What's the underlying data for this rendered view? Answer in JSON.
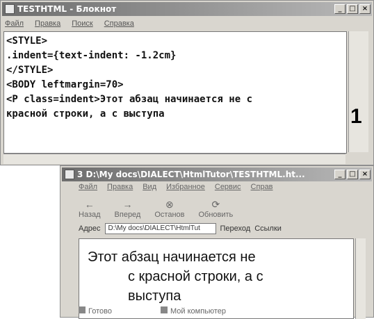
{
  "notepad": {
    "title": "TESTHTML - Блокнот",
    "menu": [
      "Файл",
      "Правка",
      "Поиск",
      "Справка"
    ],
    "lines": [
      "<STYLE>",
      ".indent={text-indent: -1.2cm}",
      "</STYLE>",
      "<BODY leftmargin=70>",
      "<P class=indent>Этот абзац начинается не с",
      "красной строки, а с выступа"
    ]
  },
  "figure_number": "1",
  "browser": {
    "title": "3  D:\\My  docs\\DIALECT\\HtmlTutor\\TESTHTML.ht...",
    "menu": [
      "Файл",
      "Правка",
      "Вид",
      "Избранное",
      "Сервис",
      "Справ"
    ],
    "toolbar": [
      "Назад",
      "Вперед",
      "Останов",
      "Обновить"
    ],
    "address_label": "Адрес",
    "address_value": "D:\\My docs\\DIALECT\\HtmlTut",
    "go_label": "Переход",
    "links_label": "Ссылки",
    "content": {
      "line1": "Этот абзац начинается не",
      "line2": "с красной строки, а с",
      "line3": "выступа"
    },
    "status": {
      "left": "Готово",
      "right": "Мой компьютер"
    }
  }
}
